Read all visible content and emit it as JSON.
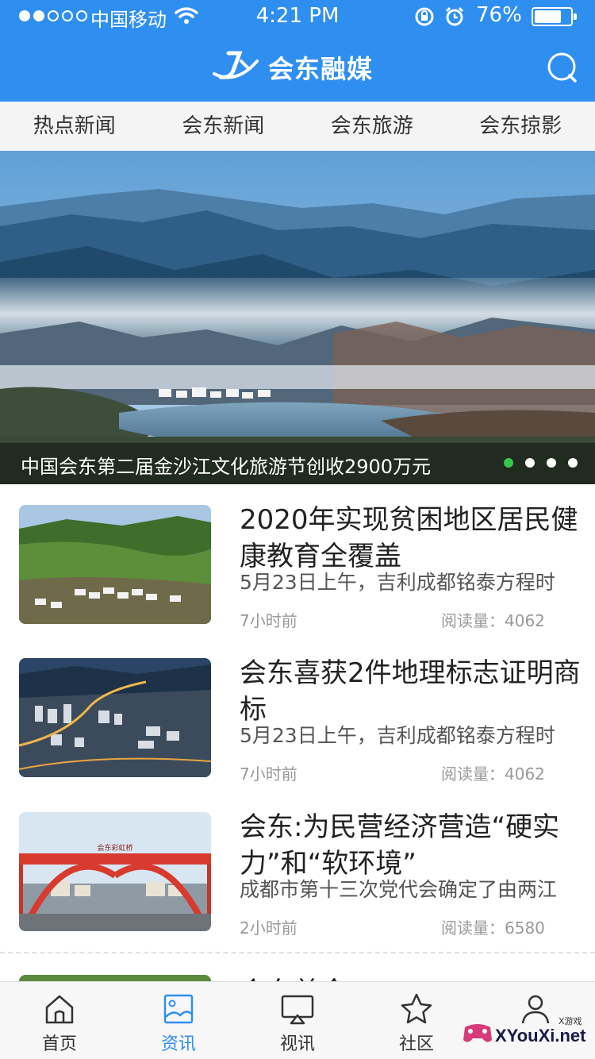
{
  "status_bar": {
    "carrier": "中国移动",
    "time": "4:21 PM",
    "battery_percent": "76%",
    "battery_level": 0.76,
    "signal_bars_filled": 2,
    "signal_bars_total": 5
  },
  "app": {
    "title": "会东融媒",
    "accent_color": "#2f8ff0"
  },
  "tabs": [
    {
      "label": "热点新闻"
    },
    {
      "label": "会东新闻"
    },
    {
      "label": "会东旅游"
    },
    {
      "label": "会东掠影"
    }
  ],
  "banner": {
    "caption": "中国会东第二届金沙江文化旅游节创收2900万元",
    "slide_count": 4,
    "active_slide": 1
  },
  "news": [
    {
      "title": "2020年实现贫困地区居民健康教育全覆盖",
      "summary": "5月23日上午，吉利成都铭泰方程时",
      "time": "7小时前",
      "reads": "阅读量：4062"
    },
    {
      "title": "会东喜获2件地理标志证明商标",
      "summary": "5月23日上午，吉利成都铭泰方程时",
      "time": "7小时前",
      "reads": "阅读量：4062"
    },
    {
      "title": "会东:为民营经济营造“硬实力”和“软环境”",
      "summary": "成都市第十三次党代会确定了由两江",
      "time": "2小时前",
      "reads": "阅读量：6580",
      "image_sign": "会东彩虹桥"
    }
  ],
  "partial_news_title": "会东美食",
  "bottom_nav": [
    {
      "label": "首页",
      "icon": "home-icon"
    },
    {
      "label": "资讯",
      "icon": "image-icon"
    },
    {
      "label": "视讯",
      "icon": "airplay-icon"
    },
    {
      "label": "社区",
      "icon": "star-icon"
    },
    {
      "label": "",
      "icon": "user-icon"
    }
  ],
  "active_nav": 1,
  "watermark": {
    "text": "XYouXi.net",
    "small": "X游戏"
  }
}
